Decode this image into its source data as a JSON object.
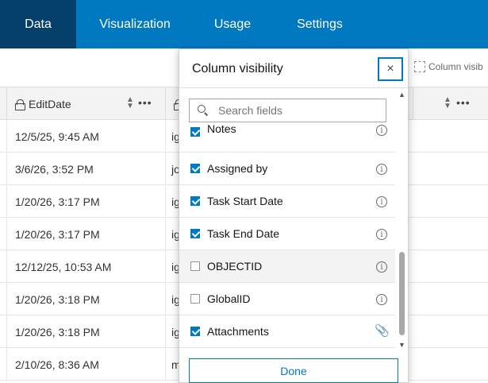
{
  "nav": {
    "tabs": [
      {
        "label": "Data",
        "active": true
      },
      {
        "label": "Visualization",
        "active": false
      },
      {
        "label": "Usage",
        "active": false
      },
      {
        "label": "Settings",
        "active": false
      }
    ]
  },
  "toolbar": {
    "column_visibility_label": "Column visib"
  },
  "table": {
    "header": {
      "edit_date": "EditDate"
    },
    "rows": [
      {
        "date": "12/5/25, 9:45 AM",
        "user": "ig"
      },
      {
        "date": "3/6/26, 3:52 PM",
        "user": "jo"
      },
      {
        "date": "1/20/26, 3:17 PM",
        "user": "ig"
      },
      {
        "date": "1/20/26, 3:17 PM",
        "user": "ig"
      },
      {
        "date": "12/12/25, 10:53 AM",
        "user": "ig"
      },
      {
        "date": "1/20/26, 3:18 PM",
        "user": "ig"
      },
      {
        "date": "1/20/26, 3:18 PM",
        "user": "ig"
      },
      {
        "date": "2/10/26, 8:36 AM",
        "user": "m"
      }
    ]
  },
  "panel": {
    "title": "Column visibility",
    "close_label": "×",
    "search_placeholder": "Search fields",
    "fields": [
      {
        "name": "Notes",
        "checked": true,
        "icon": "info-icon"
      },
      {
        "name": "Assigned by",
        "checked": true,
        "icon": "info-icon"
      },
      {
        "name": "Task Start Date",
        "checked": true,
        "icon": "info-icon"
      },
      {
        "name": "Task End Date",
        "checked": true,
        "icon": "info-icon"
      },
      {
        "name": "OBJECTID",
        "checked": false,
        "icon": "info-icon"
      },
      {
        "name": "GlobalID",
        "checked": false,
        "icon": "info-icon"
      },
      {
        "name": "Attachments",
        "checked": true,
        "icon": "paperclip-icon"
      }
    ],
    "done_label": "Done"
  },
  "colors": {
    "accent": "#0079c1",
    "nav_active": "#05406b"
  }
}
